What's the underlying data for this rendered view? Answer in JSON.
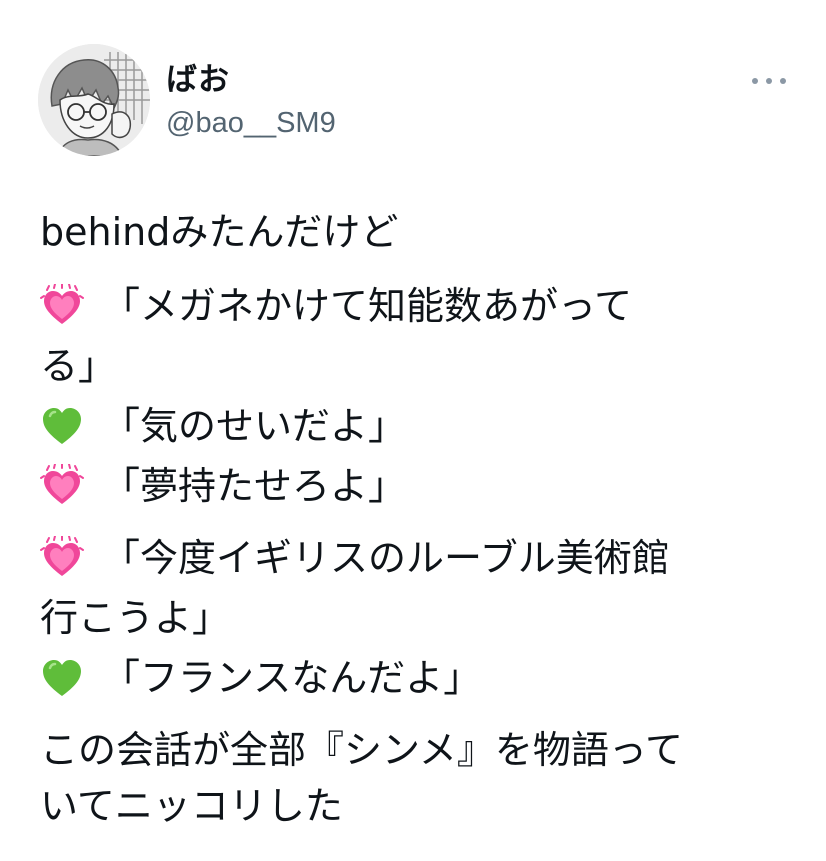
{
  "user": {
    "display_name": "ばお",
    "handle": "@bao__SM9"
  },
  "header": {
    "more_icon": "more-horizontal-icon"
  },
  "tweet": {
    "lines": [
      {
        "emoji": null,
        "text": "behindみたんだけど"
      },
      {
        "emoji": "sparkling-pink-heart",
        "text": "「メガネかけて知能数あがって"
      },
      {
        "emoji": null,
        "text": "る」"
      },
      {
        "emoji": "green-heart",
        "text": "「気のせいだよ」"
      },
      {
        "emoji": "sparkling-pink-heart",
        "text": "「夢持たせろよ」"
      },
      {
        "emoji": "sparkling-pink-heart",
        "text": "「今度イギリスのルーブル美術館"
      },
      {
        "emoji": null,
        "text": "行こうよ」"
      },
      {
        "emoji": "green-heart",
        "text": "「フランスなんだよ」"
      },
      {
        "emoji": null,
        "text": "この会話が全部『シンメ』を物語って"
      },
      {
        "emoji": null,
        "text": "いてニッコリした"
      }
    ]
  },
  "colors": {
    "text": "#0f1419",
    "secondary": "#536471",
    "pink_heart": "#f0479a",
    "green_heart": "#5fbd3a"
  }
}
